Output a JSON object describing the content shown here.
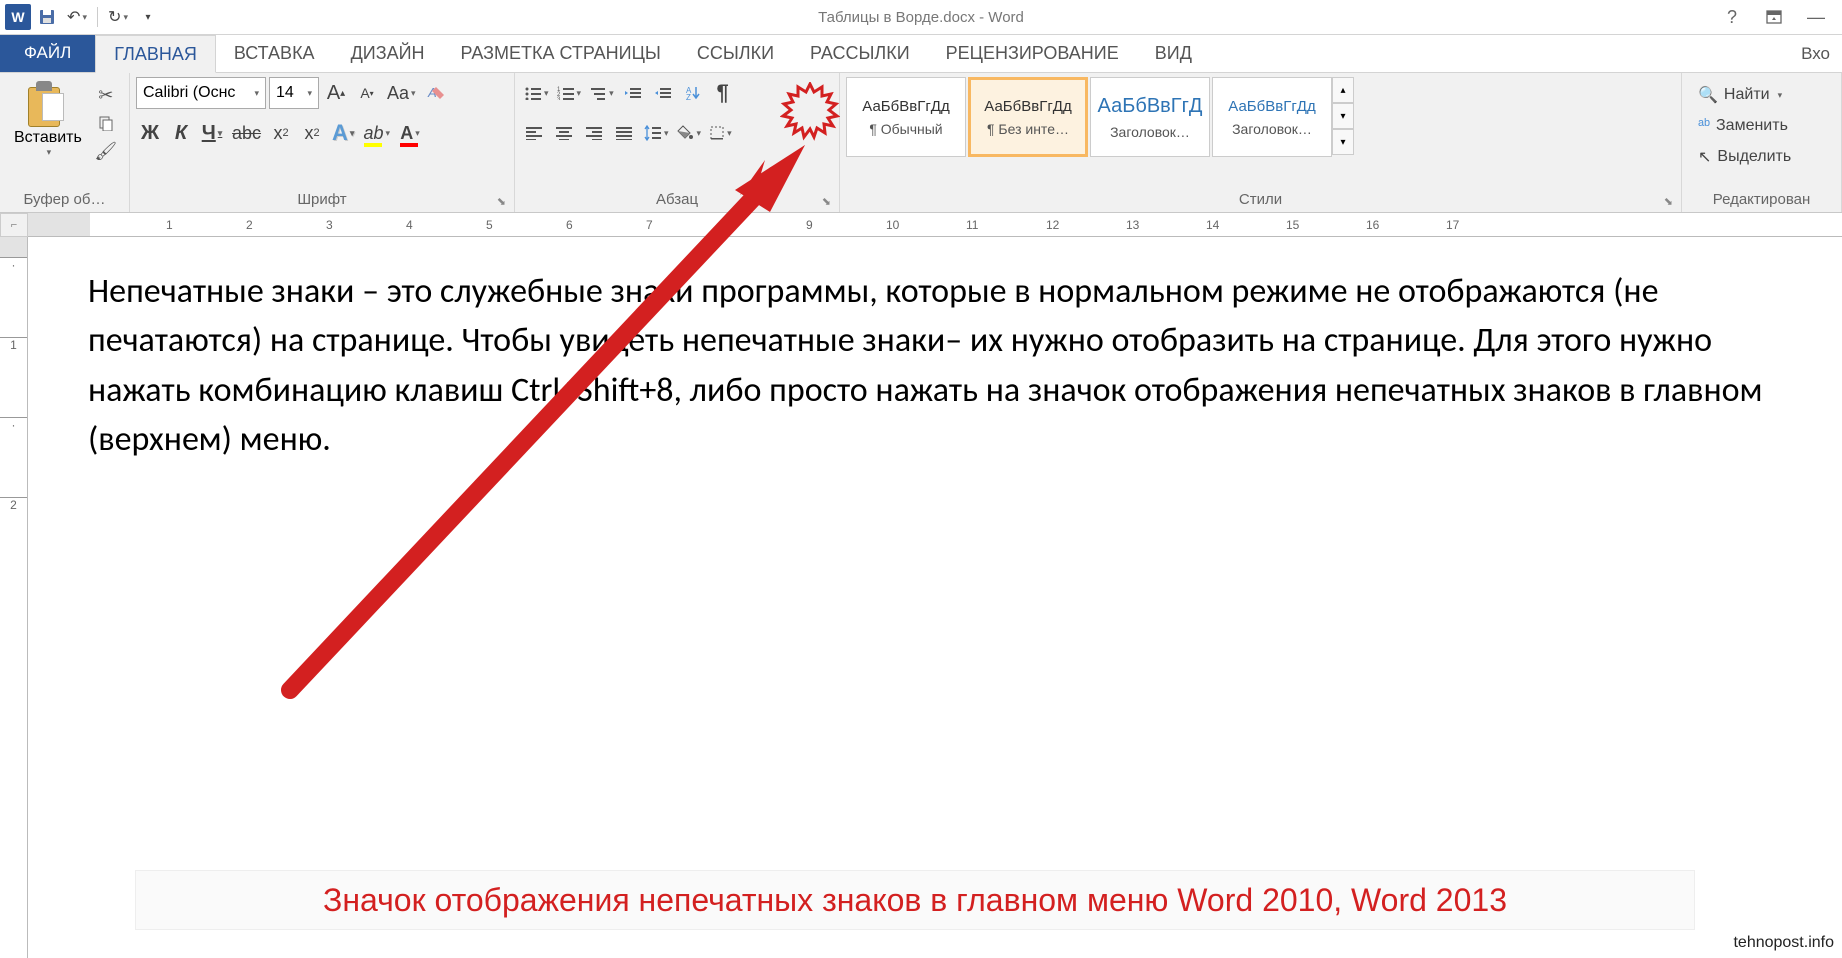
{
  "title": "Таблицы в Ворде.docx - Word",
  "qat": {
    "save": "💾",
    "undo": "↶",
    "redo": "↷"
  },
  "tabs": {
    "file": "ФАЙЛ",
    "home": "ГЛАВНАЯ",
    "insert": "ВСТАВКА",
    "design": "ДИЗАЙН",
    "layout": "РАЗМЕТКА СТРАНИЦЫ",
    "references": "ССЫЛКИ",
    "mailings": "РАССЫЛКИ",
    "review": "РЕЦЕНЗИРОВАНИЕ",
    "view": "ВИД",
    "signin": "Вхо"
  },
  "ribbon": {
    "clipboard": {
      "label": "Буфер об…",
      "paste": "Вставить"
    },
    "font": {
      "label": "Шрифт",
      "name": "Calibri (Оснс",
      "size": "14",
      "bold": "Ж",
      "italic": "К",
      "underline": "Ч",
      "strike": "abc",
      "sub": "x₂",
      "sup": "x²",
      "grow": "A",
      "shrink": "A",
      "case": "Aa",
      "clear": "🧹",
      "effects": "A",
      "highlight": "ab",
      "color": "A"
    },
    "paragraph": {
      "label": "Абзац",
      "pilcrow": "¶"
    },
    "styles": {
      "label": "Стили",
      "items": [
        {
          "preview": "АаБбВвГгДд",
          "name": "¶ Обычный",
          "cls": ""
        },
        {
          "preview": "АаБбВвГгДд",
          "name": "¶ Без инте…",
          "cls": "selected"
        },
        {
          "preview": "АаБбВвГгД",
          "name": "Заголовок…",
          "cls": ""
        },
        {
          "preview": "АаБбВвГгДд",
          "name": "Заголовок…",
          "cls": ""
        }
      ]
    },
    "editing": {
      "label": "Редактирован",
      "find": "Найти",
      "replace": "Заменить",
      "select": "Выделить"
    }
  },
  "ruler": {
    "max": 17
  },
  "document": {
    "p1": "Непечатные знаки – это служебные знаки программы, которые в нормальном режиме не отображаются (не печатаются) на странице. Чтобы увидеть непечатные знаки– их нужно отобразить на странице. Для этого нужно нажать комбинацию клавиш Ctrl+Shift+8, либо просто нажать на значок отображения непечатных знаков в главном (верхнем) меню."
  },
  "caption": "Значок отображения непечатных знаков в главном меню Word 2010, Word   2013",
  "watermark": "tehnopost.info"
}
